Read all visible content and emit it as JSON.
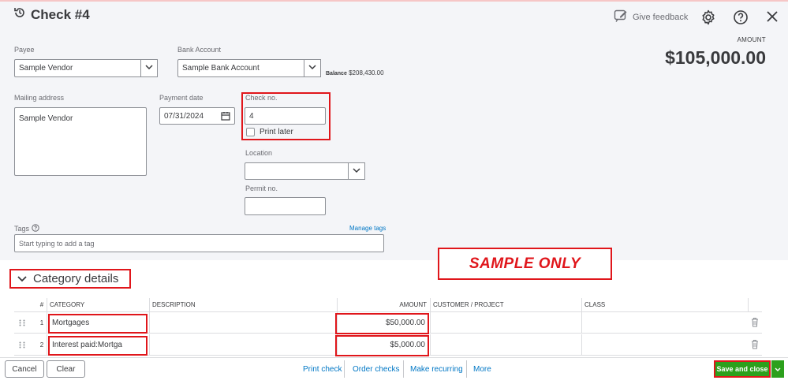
{
  "header": {
    "title": "Check #4",
    "feedback_label": "Give feedback"
  },
  "form": {
    "payee_label": "Payee",
    "payee_value": "Sample Vendor",
    "bank_label": "Bank Account",
    "bank_value": "Sample Bank Account",
    "balance_label": "Balance",
    "balance_value": "$208,430.00",
    "amount_label": "AMOUNT",
    "amount_value": "$105,000.00",
    "mailing_label": "Mailing address",
    "mailing_value": "Sample Vendor",
    "payment_date_label": "Payment date",
    "payment_date_value": "07/31/2024",
    "check_no_label": "Check no.",
    "check_no_value": "4",
    "print_later_label": "Print later",
    "location_label": "Location",
    "location_value": "",
    "permit_label": "Permit no.",
    "permit_value": "",
    "tags_label": "Tags",
    "manage_tags_label": "Manage tags",
    "tags_placeholder": "Start typing to add a tag"
  },
  "watermark": "SAMPLE ONLY",
  "category": {
    "title": "Category details",
    "columns": [
      "#",
      "CATEGORY",
      "DESCRIPTION",
      "AMOUNT",
      "CUSTOMER / PROJECT",
      "CLASS"
    ],
    "rows": [
      {
        "num": "1",
        "category": "Mortgages",
        "description": "",
        "amount": "$50,000.00",
        "customer": "",
        "class": ""
      },
      {
        "num": "2",
        "category": "Interest paid:Mortga",
        "description": "",
        "amount": "$5,000.00",
        "customer": "",
        "class": ""
      }
    ]
  },
  "footer": {
    "cancel_label": "Cancel",
    "clear_label": "Clear",
    "print_check_label": "Print check",
    "order_checks_label": "Order checks",
    "make_recurring_label": "Make recurring",
    "more_label": "More",
    "save_close_label": "Save and close"
  },
  "colors": {
    "accent_green": "#2ca01c",
    "link_blue": "#0077c5",
    "annotation_red": "#e0161b"
  },
  "icons": [
    "history-icon",
    "feedback-icon",
    "gear-icon",
    "help-icon",
    "close-icon",
    "chevron-down-icon",
    "calendar-icon",
    "info-icon",
    "drag-handle-icon",
    "trash-icon"
  ]
}
